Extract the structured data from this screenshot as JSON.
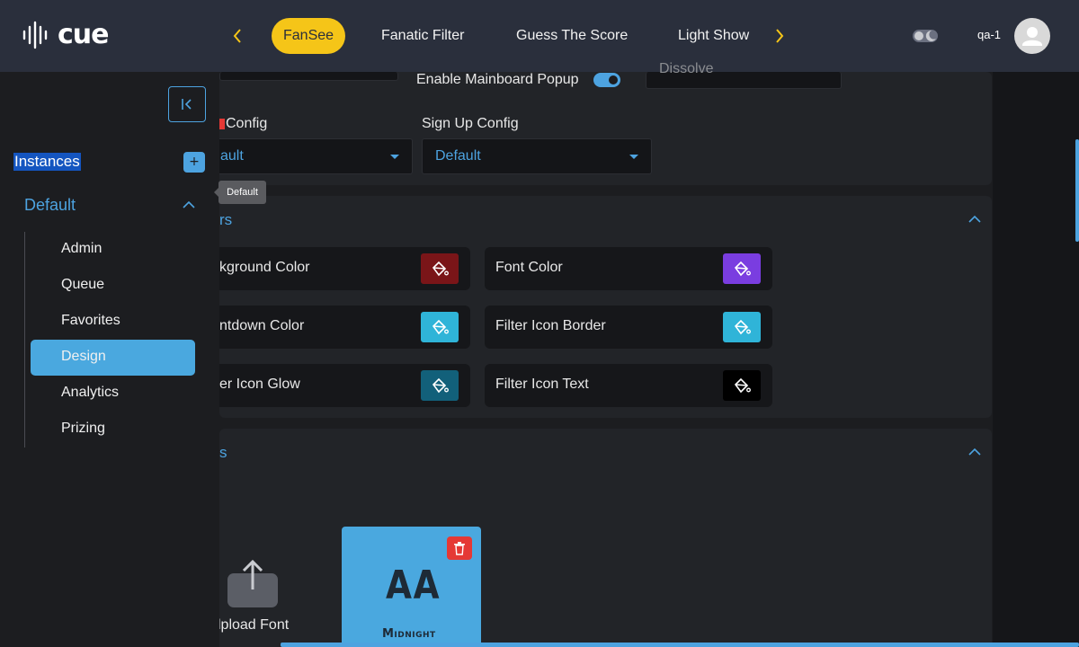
{
  "header": {
    "logo_text": "cue",
    "tabs": [
      {
        "label": "FanSee",
        "active": true
      },
      {
        "label": "Fanatic Filter",
        "active": false
      },
      {
        "label": "Guess The Score",
        "active": false
      },
      {
        "label": "Light Show",
        "active": false
      }
    ],
    "user_name": "qa-1",
    "accent_color": "#f5c518"
  },
  "sidebar": {
    "section_title": "Instances",
    "add_label": "+",
    "tooltip": "Default",
    "instance_name": "Default",
    "items": [
      {
        "label": "Admin",
        "active": false
      },
      {
        "label": "Queue",
        "active": false
      },
      {
        "label": "Favorites",
        "active": false
      },
      {
        "label": "Design",
        "active": true
      },
      {
        "label": "Analytics",
        "active": false
      },
      {
        "label": "Prizing",
        "active": false
      }
    ],
    "accent_color": "#4aa8df"
  },
  "config": {
    "partial_label": "Dissolve",
    "enable_popup_label": "Enable Mainboard Popup",
    "enable_popup_on": true,
    "login_config_label": "Config",
    "login_config_value": "ault",
    "signup_config_label": "Sign Up Config",
    "signup_config_value": "Default"
  },
  "colors_section": {
    "title_partial": "rs",
    "items": [
      {
        "label": "kground Color",
        "color": "#7a1518"
      },
      {
        "label": "Font Color",
        "color": "#7a3de0"
      },
      {
        "label": "ntdown Color",
        "color": "#2fb4d8"
      },
      {
        "label": "Filter Icon Border",
        "color": "#2fb4d8"
      },
      {
        "label": "er Icon Glow",
        "color": "#12607a"
      },
      {
        "label": "Filter Icon Text",
        "color": "#000000"
      }
    ]
  },
  "fonts_section": {
    "title_partial": "s",
    "upload_label": "Upload Font",
    "upload_label_visible": "lpload Font",
    "font_tile": {
      "preview": "AA",
      "name": "Midnight"
    }
  }
}
